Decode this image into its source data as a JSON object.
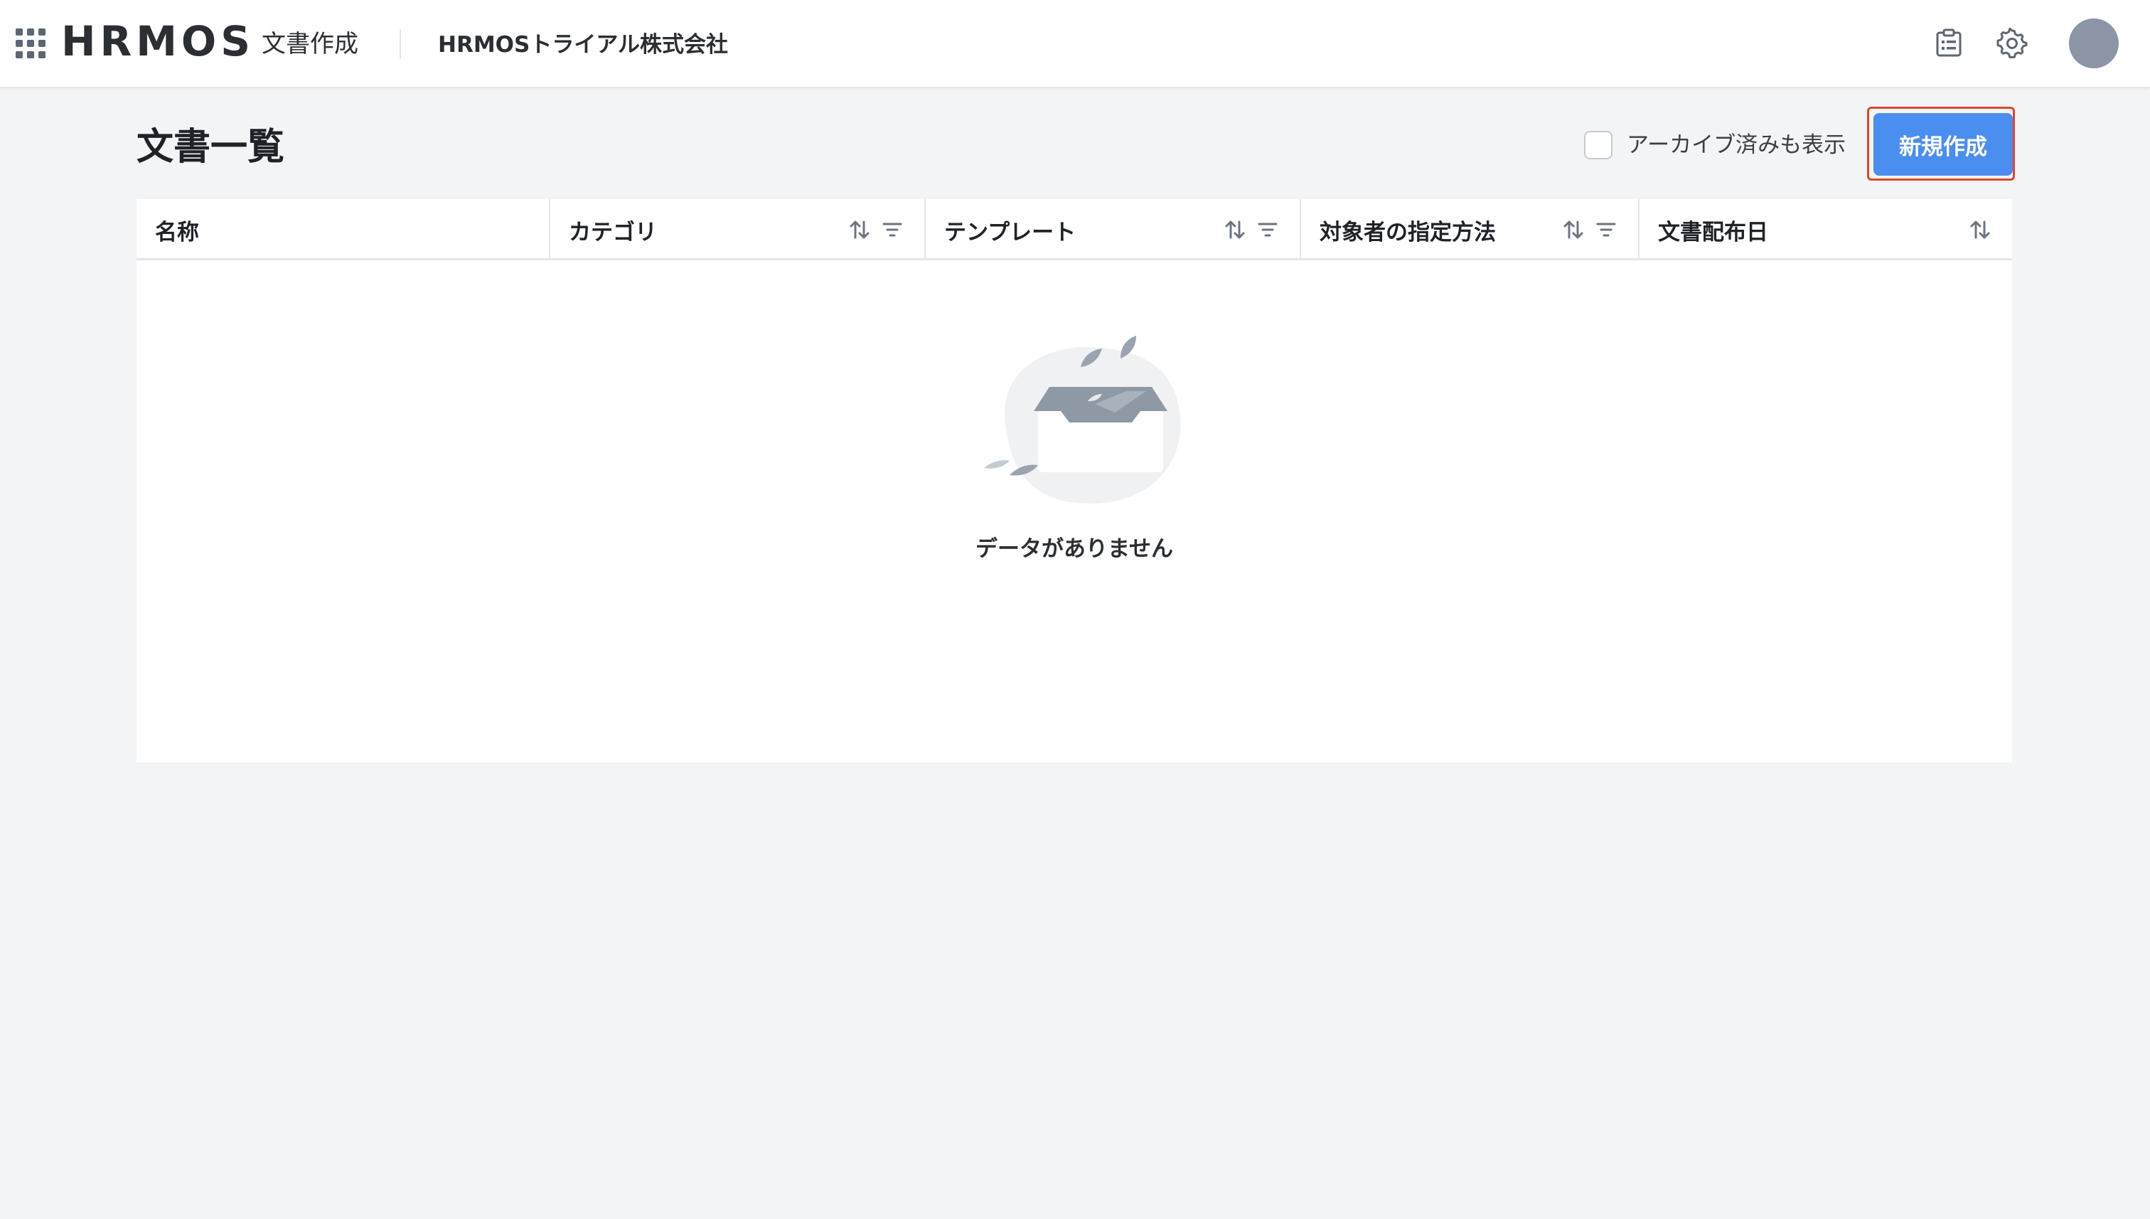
{
  "header": {
    "logo": "HRMOS",
    "product_name": "文書作成",
    "company_name": "HRMOSトライアル株式会社",
    "icons": [
      "app-grid-icon",
      "clipboard-list-icon",
      "gear-icon",
      "avatar"
    ]
  },
  "page": {
    "title": "文書一覧",
    "archive_toggle_label": "アーカイブ済みも表示",
    "archive_checked": false,
    "create_button_label": "新規作成"
  },
  "table": {
    "columns": [
      {
        "label": "名称",
        "sortable": false,
        "filterable": false
      },
      {
        "label": "カテゴリ",
        "sortable": true,
        "filterable": true
      },
      {
        "label": "テンプレート",
        "sortable": true,
        "filterable": true
      },
      {
        "label": "対象者の指定方法",
        "sortable": true,
        "filterable": true
      },
      {
        "label": "文書配布日",
        "sortable": true,
        "filterable": false
      }
    ],
    "rows": [],
    "empty_message": "データがありません"
  },
  "colors": {
    "primary": "#4a8ff0",
    "highlight": "#e0432e",
    "background": "#f3f4f6",
    "avatar": "#8b95a6",
    "icon": "#5c6773"
  }
}
